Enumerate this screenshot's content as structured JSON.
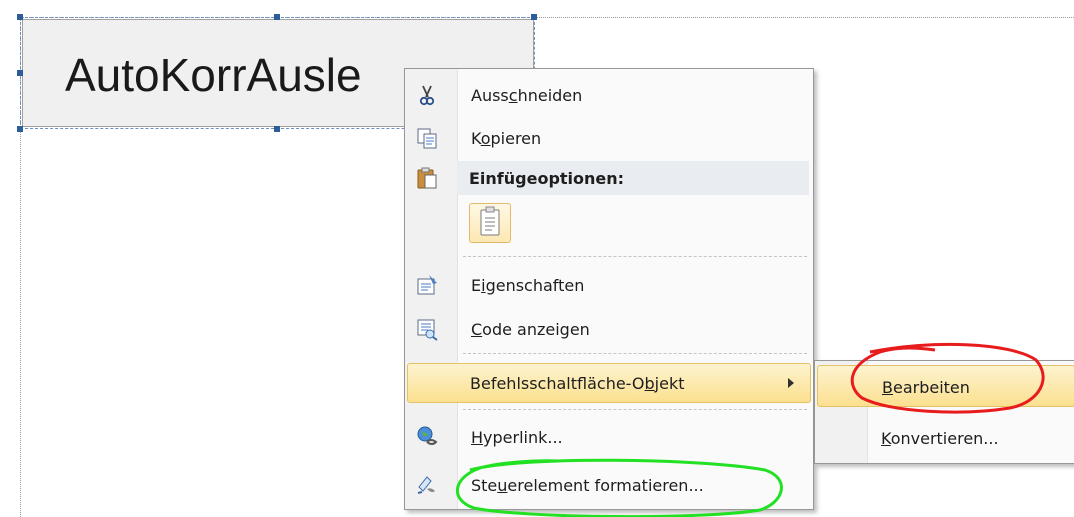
{
  "canvas": {
    "button_label": "AutoKorrAusle"
  },
  "context_menu": {
    "items": [
      {
        "id": "cut",
        "pre": "Auss",
        "ul": "c",
        "post": "hneiden",
        "icon": "scissors-icon"
      },
      {
        "id": "copy",
        "pre": "K",
        "ul": "o",
        "post": "pieren",
        "icon": "copy-icon"
      },
      {
        "id": "paste-options",
        "label": "Einfügeoptionen:",
        "icon": "clipboard-icon"
      },
      {
        "id": "properties",
        "pre": "E",
        "ul": "i",
        "post": "genschaften",
        "icon": "properties-icon"
      },
      {
        "id": "view-code",
        "pre": "",
        "ul": "C",
        "post": "ode anzeigen",
        "icon": "view-code-icon"
      },
      {
        "id": "button-object",
        "pre": "Befehlsschaltfläche-O",
        "ul": "b",
        "post": "jekt",
        "icon": ""
      },
      {
        "id": "hyperlink",
        "pre": "",
        "ul": "H",
        "post": "yperlink...",
        "icon": "globe-link-icon"
      },
      {
        "id": "format-control",
        "pre": "Ste",
        "ul": "u",
        "post": "erelement formatieren...",
        "icon": "format-icon"
      }
    ]
  },
  "submenu": {
    "items": [
      {
        "id": "edit",
        "pre": "",
        "ul": "B",
        "post": "earbeiten"
      },
      {
        "id": "convert",
        "pre": "",
        "ul": "K",
        "post": "onvertieren..."
      }
    ]
  },
  "colors": {
    "hover_highlight": "#fbe08f",
    "annotation_red": "#e81c1c",
    "annotation_green": "#22e022"
  }
}
